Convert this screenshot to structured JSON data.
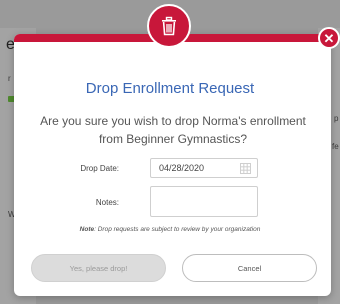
{
  "background": {
    "fragment_e": "e",
    "fragment_r": "r",
    "fragment_w": "W",
    "fragment_p": "p",
    "fragment_fe": "fe"
  },
  "modal": {
    "title": "Drop Enrollment Request",
    "question": "Are you sure you wish to drop Norma's enrollment from Beginner Gymnastics?",
    "drop_date_label": "Drop Date:",
    "drop_date_value": "04/28/2020",
    "notes_label": "Notes:",
    "notes_value": "",
    "note_prefix": "Note",
    "note_text": ": Drop requests are subject to review by your organization",
    "confirm_button": "Yes, please drop!",
    "cancel_button": "Cancel",
    "header_icon": "trash-icon",
    "close_icon": "close-icon"
  },
  "colors": {
    "accent_red": "#c8173a",
    "title_blue": "#3a67b5",
    "disabled_button": "#dcdcdc"
  }
}
